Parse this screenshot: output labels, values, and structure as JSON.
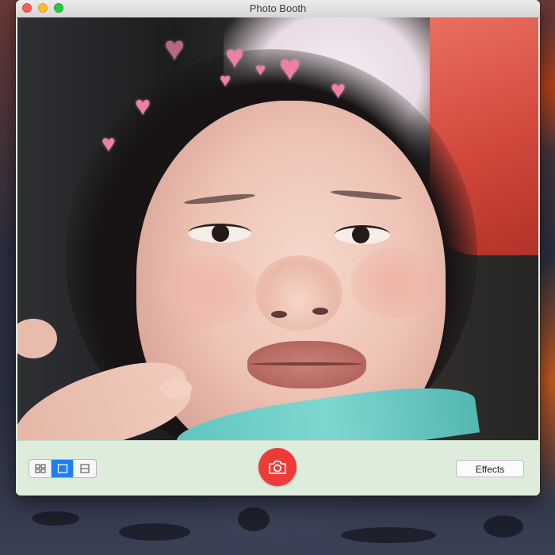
{
  "window": {
    "title": "Photo Booth"
  },
  "toolbar": {
    "layout_options": [
      {
        "name": "grid-of-four",
        "icon": "grid-four-icon",
        "selected": false
      },
      {
        "name": "single-photo",
        "icon": "single-frame-icon",
        "selected": true
      },
      {
        "name": "filmstrip",
        "icon": "filmstrip-icon",
        "selected": false
      }
    ],
    "shutter_icon": "camera-icon",
    "effects_label": "Effects"
  },
  "colors": {
    "accent": "#1f7ff2",
    "shutter": "#ef3b37",
    "toolbar": "#ddecdb"
  },
  "viewport": {
    "effect": "hearts",
    "heart_count": 8
  }
}
